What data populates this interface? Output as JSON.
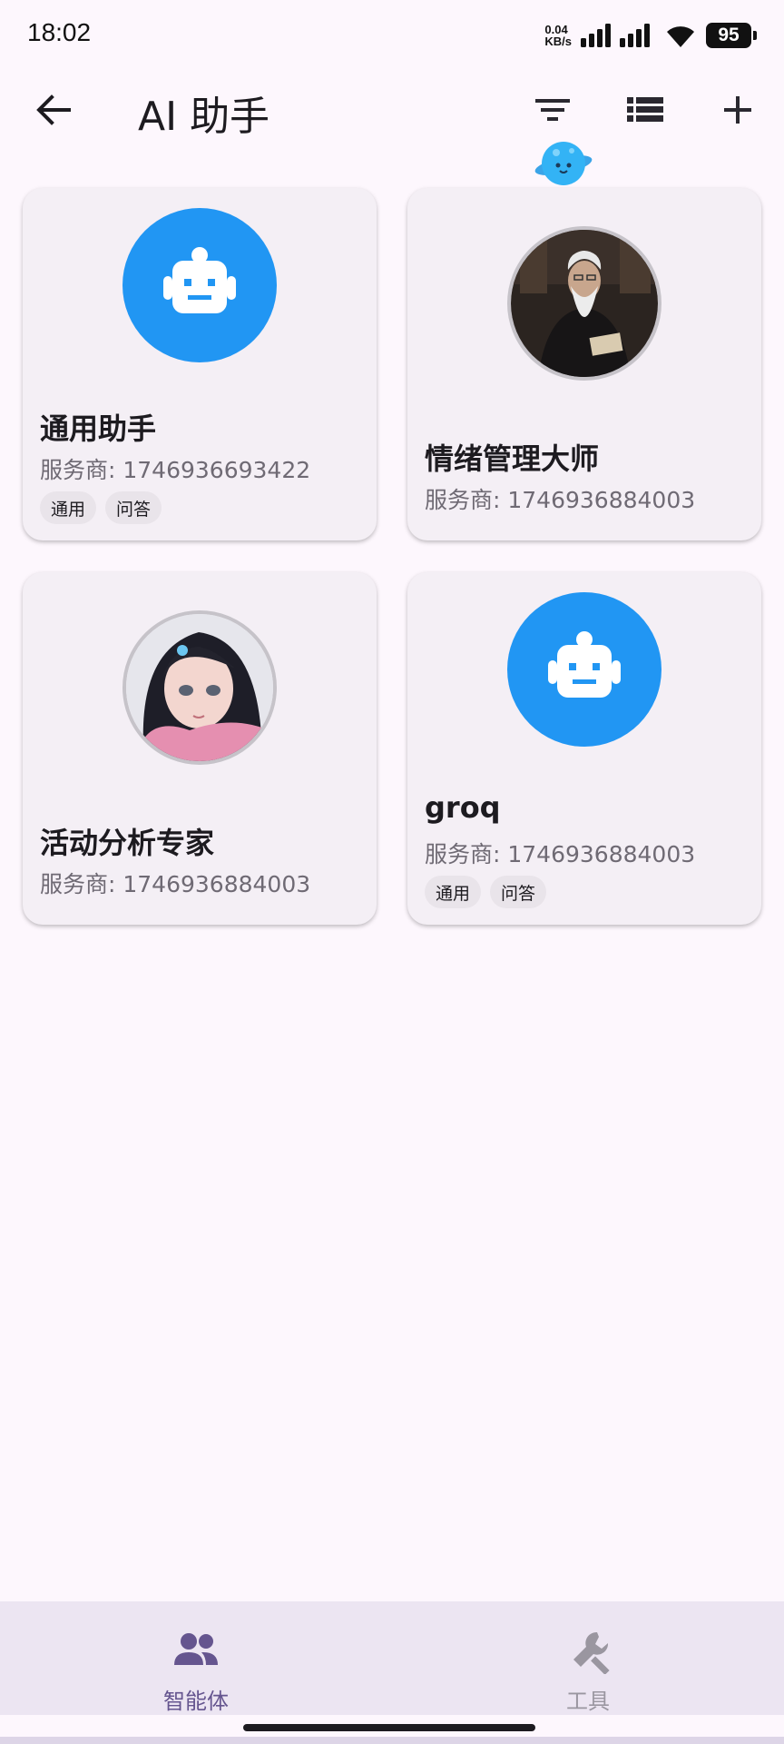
{
  "status_bar": {
    "time": "18:02",
    "net_speed_value": "0.04",
    "net_speed_unit": "KB/s",
    "battery": "95"
  },
  "app_bar": {
    "title": "AI 助手",
    "icons": [
      "back-arrow-icon",
      "filter-icon",
      "list-view-icon",
      "add-icon"
    ]
  },
  "cards": [
    {
      "name": "通用助手",
      "provider": "服务商: 1746936693422",
      "tags": [
        "通用",
        "问答"
      ],
      "avatar": "robot-icon"
    },
    {
      "name": "情绪管理大师",
      "provider": "服务商: 1746936884003",
      "tags": [],
      "avatar": "elder-wizard-portrait"
    },
    {
      "name": "活动分析专家",
      "provider": "服务商: 1746936884003",
      "tags": [],
      "avatar": "girl-portrait"
    },
    {
      "name": "groq",
      "provider": "服务商: 1746936884003",
      "tags": [
        "通用",
        "问答"
      ],
      "avatar": "robot-icon"
    }
  ],
  "bottom_nav": {
    "items": [
      {
        "label": "智能体",
        "icon": "people-icon",
        "active": true
      },
      {
        "label": "工具",
        "icon": "wrench-icon",
        "active": false
      }
    ]
  },
  "colors": {
    "background": "#fdf7fd",
    "card": "#f4eff5",
    "robot_avatar": "#2196f3",
    "nav_active": "#65558f",
    "nav_inactive": "#9a96a0"
  }
}
